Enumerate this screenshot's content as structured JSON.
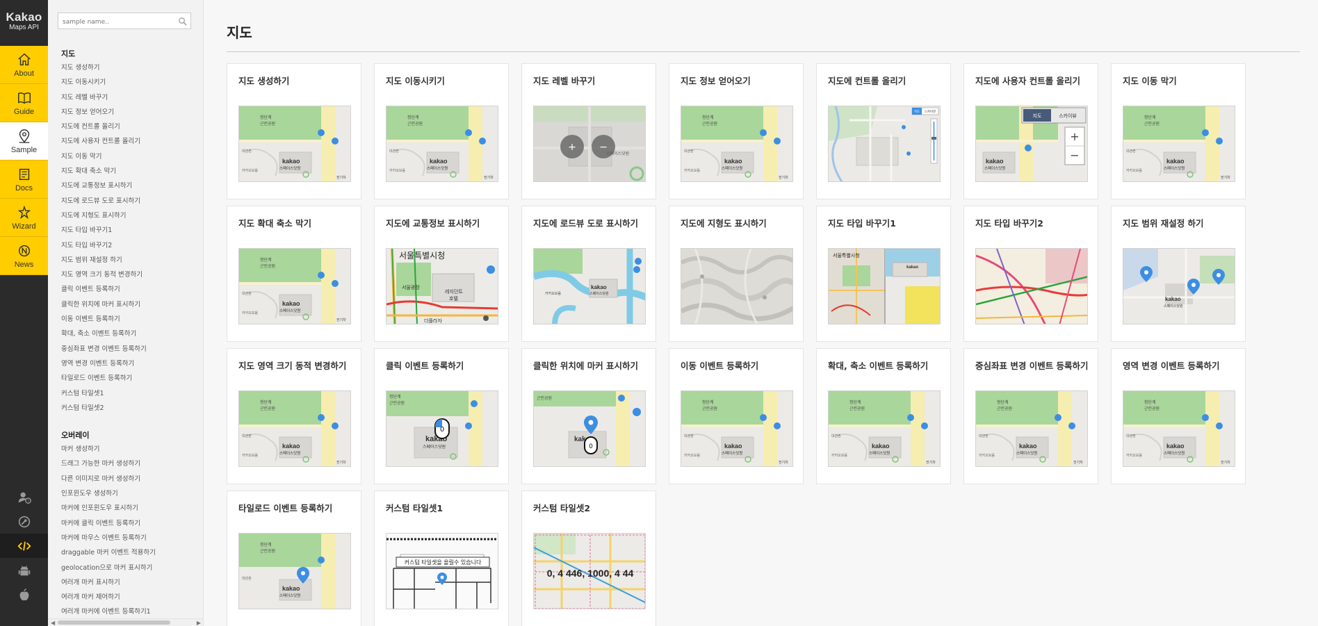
{
  "brand": {
    "line1": "Kakao",
    "line2": "Maps API"
  },
  "rail": [
    {
      "label": "About",
      "icon": "home-icon"
    },
    {
      "label": "Guide",
      "icon": "book-icon"
    },
    {
      "label": "Sample",
      "icon": "map-pin-icon",
      "active": true
    },
    {
      "label": "Docs",
      "icon": "docs-icon"
    },
    {
      "label": "Wizard",
      "icon": "wizard-icon"
    },
    {
      "label": "News",
      "icon": "news-icon"
    }
  ],
  "rail_bottom": [
    "user-help-icon",
    "key-icon",
    "code-icon",
    "android-icon",
    "apple-icon"
  ],
  "search": {
    "placeholder": "sample name.."
  },
  "sidebar": {
    "section1": {
      "title": "지도",
      "items": [
        "지도 생성하기",
        "지도 이동시키기",
        "지도 레벨 바꾸기",
        "지도 정보 얻어오기",
        "지도에 컨트롤 올리기",
        "지도에 사용자 컨트롤 올리기",
        "지도 이동 막기",
        "지도 확대 축소 막기",
        "지도에 교통정보 표시하기",
        "지도에 로드뷰 도로 표시하기",
        "지도에 지형도 표시하기",
        "지도 타입 바꾸기1",
        "지도 타입 바꾸기2",
        "지도 범위 재설정 하기",
        "지도 영역 크기 동적 변경하기",
        "클릭 이벤트 등록하기",
        "클릭한 위치에 마커 표시하기",
        "이동 이벤트 등록하기",
        "확대, 축소 이벤트 등록하기",
        "중심좌표 변경 이벤트 등록하기",
        "영역 변경 이벤트 등록하기",
        "타일로드 이벤트 등록하기",
        "커스텀 타일셋1",
        "커스텀 타일셋2"
      ]
    },
    "section2": {
      "title": "오버레이",
      "items": [
        "마커 생성하기",
        "드래그 가능한 마커 생성하기",
        "다른 이미지로 마커 생성하기",
        "인포윈도우 생성하기",
        "마커에 인포윈도우 표시하기",
        "마커에 클릭 이벤트 등록하기",
        "마커에 마우스 이벤트 등록하기",
        "draggable 마커 이벤트 적용하기",
        "geolocation으로 마커 표시하기",
        "여러개 마커 표시하기",
        "여러개 마커 제어하기",
        "여러개 마커에 이벤트 등록하기1"
      ]
    }
  },
  "main": {
    "title": "지도"
  },
  "thumb_text": {
    "place1": "청단계",
    "place2": "근린공원",
    "place3": "대관촌",
    "place4": "카카오모음",
    "logo": "kakao",
    "space": "스페이스닷원",
    "edge": "전기차",
    "maptype_map": "지도",
    "maptype_sky": "스카이뷰",
    "zoom_in": "+",
    "zoom_out": "−",
    "seoul_hall": "서울특별시청",
    "plaza": "서울광장",
    "hotel1": "레지던트",
    "hotel2": "호텔",
    "plaza_bldg": "더플라자",
    "click_num": "0",
    "tileset_label": "커스텀 타일셋을 올릴수 있습니다",
    "tileset_coord": "0, 4   446, 1000, 4   44"
  },
  "cards": [
    {
      "title": "지도 생성하기",
      "thumb": "base"
    },
    {
      "title": "지도 이동시키기",
      "thumb": "base"
    },
    {
      "title": "지도 레벨 바꾸기",
      "thumb": "level"
    },
    {
      "title": "지도 정보 얻어오기",
      "thumb": "base"
    },
    {
      "title": "지도에 컨트롤 올리기",
      "thumb": "control"
    },
    {
      "title": "지도에 사용자 컨트롤 올리기",
      "thumb": "usercontrol"
    },
    {
      "title": "지도 이동 막기",
      "thumb": "base"
    },
    {
      "title": "지도 확대 축소 막기",
      "thumb": "base"
    },
    {
      "title": "지도에 교통정보 표시하기",
      "thumb": "traffic"
    },
    {
      "title": "지도에 로드뷰 도로 표시하기",
      "thumb": "roadview"
    },
    {
      "title": "지도에 지형도 표시하기",
      "thumb": "terrain"
    },
    {
      "title": "지도 타입 바꾸기1",
      "thumb": "maptype1"
    },
    {
      "title": "지도 타입 바꾸기2",
      "thumb": "maptype2"
    },
    {
      "title": "지도 범위 재설정 하기",
      "thumb": "bounds"
    },
    {
      "title": "지도 영역 크기 동적 변경하기",
      "thumb": "base"
    },
    {
      "title": "클릭 이벤트 등록하기",
      "thumb": "click"
    },
    {
      "title": "클릭한 위치에 마커 표시하기",
      "thumb": "clickmarker"
    },
    {
      "title": "이동 이벤트 등록하기",
      "thumb": "base"
    },
    {
      "title": "확대, 축소 이벤트 등록하기",
      "thumb": "base"
    },
    {
      "title": "중심좌표 변경 이벤트 등록하기",
      "thumb": "base"
    },
    {
      "title": "영역 변경 이벤트 등록하기",
      "thumb": "base"
    },
    {
      "title": "타일로드 이벤트 등록하기",
      "thumb": "marker"
    },
    {
      "title": "커스텀 타일셋1",
      "thumb": "tileset1"
    },
    {
      "title": "커스텀 타일셋2",
      "thumb": "tileset2"
    }
  ],
  "colors": {
    "rail_bg": "#2b2b2b",
    "rail_accent": "#ffcd00",
    "marker_blue": "#3c8ee3",
    "park_green": "#9bd18a"
  }
}
